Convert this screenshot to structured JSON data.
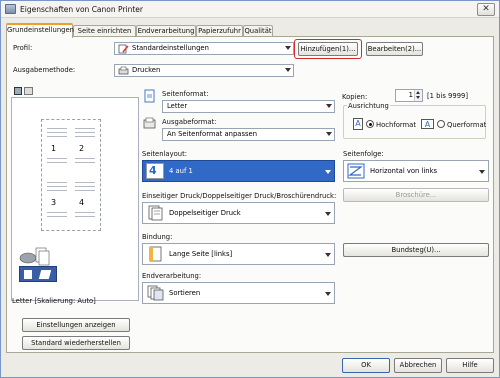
{
  "window": {
    "title": "Eigenschaften von Canon Printer",
    "close": "✕"
  },
  "tabs": [
    "Grundeinstellungen",
    "Seite einrichten",
    "Endverarbeitung",
    "Papierzufuhr",
    "Qualität"
  ],
  "profile": {
    "label": "Profil:",
    "value": "Standardeinstellungen",
    "add": "Hinzufügen(1)...",
    "edit": "Bearbeiten(2)..."
  },
  "output": {
    "label": "Ausgabemethode:",
    "value": "Drucken"
  },
  "page_format": {
    "label": "Seitenformat:",
    "value": "Letter"
  },
  "output_format": {
    "label": "Ausgabeformat:",
    "value": "An Seitenformat anpassen"
  },
  "copies": {
    "label": "Kopien:",
    "value": "1",
    "range": "[1 bis 9999]"
  },
  "orientation": {
    "label": "Ausrichtung",
    "portrait": "Hochformat",
    "landscape": "Querformat",
    "selected": "Hochformat"
  },
  "layout": {
    "label": "Seitenlayout:",
    "value": "4 auf 1",
    "badge": "4"
  },
  "page_order": {
    "label": "Seitenfolge:",
    "value": "Horizontal von links",
    "brochure": "Broschüre..."
  },
  "duplex": {
    "label": "Einseitiger Druck/Doppelseitiger Druck/Broschürendruck:",
    "value": "Doppelseitiger Druck"
  },
  "binding": {
    "label": "Bindung:",
    "value": "Lange Seite [links]",
    "margin": "Bundsteg(U)..."
  },
  "finishing": {
    "label": "Endverarbeitung:",
    "value": "Sortieren"
  },
  "preview": {
    "status": "Letter [Skalierung: Auto]",
    "page_numbers": [
      "1",
      "2",
      "3",
      "4"
    ]
  },
  "left_buttons": {
    "show": "Einstellungen anzeigen",
    "restore": "Standard wiederherstellen"
  },
  "footer": {
    "ok": "OK",
    "cancel": "Abbrechen",
    "help": "Hilfe"
  },
  "colors": {
    "highlight": "#3169c6",
    "tab_accent": "#e8a12c",
    "focus_ring": "#d32b2b"
  }
}
